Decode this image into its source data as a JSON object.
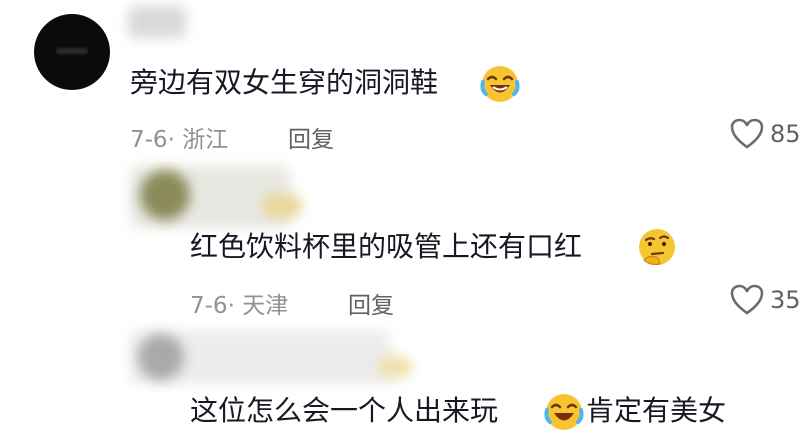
{
  "comments": [
    {
      "text": "旁边有双女生穿的洞洞鞋",
      "emoji": "laughing-crying-emoji",
      "meta": "7-6· 浙江",
      "reply": "回复",
      "likes": "85"
    },
    {
      "text": "红色饮料杯里的吸管上还有口红",
      "emoji": "thinking-emoji",
      "meta": "7-6· 天津",
      "reply": "回复",
      "likes": "35"
    },
    {
      "text": "这位怎么会一个人出来玩",
      "emoji": "laughing-crying-emoji",
      "text2": "肯定有美女",
      "meta": "",
      "reply": "",
      "likes": ""
    }
  ],
  "colors": {
    "text": "#161823",
    "meta": "#8f9196",
    "emoji_yellow": "#f7c531"
  }
}
